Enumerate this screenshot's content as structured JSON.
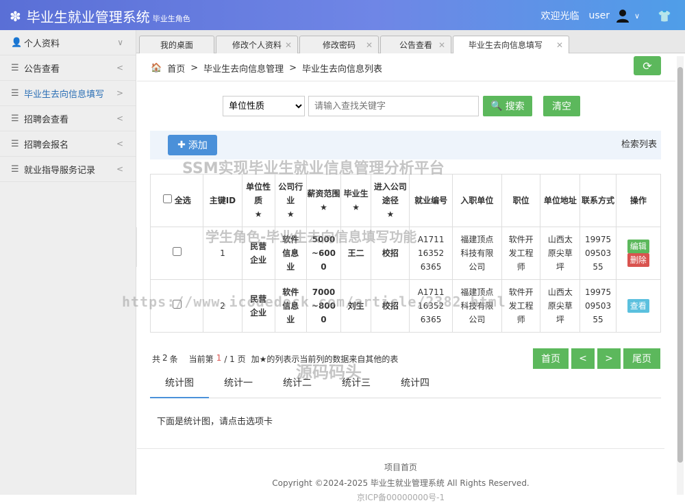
{
  "header": {
    "title": "毕业生就业管理系统",
    "role": "毕业生角色",
    "welcome": "欢迎光临",
    "username": "user"
  },
  "sidebar": {
    "items": [
      {
        "label": "个人资料",
        "icon": "user-icon",
        "arrow": "∨"
      },
      {
        "label": "公告查看",
        "icon": "list-icon",
        "arrow": "<"
      },
      {
        "label": "毕业生去向信息填写",
        "icon": "list-icon",
        "arrow": ">"
      },
      {
        "label": "招聘会查看",
        "icon": "list-icon",
        "arrow": "<"
      },
      {
        "label": "招聘会报名",
        "icon": "list-icon",
        "arrow": "<"
      },
      {
        "label": "就业指导服务记录",
        "icon": "list-icon",
        "arrow": "<"
      }
    ]
  },
  "tabs": [
    {
      "label": "我的桌面"
    },
    {
      "label": "修改个人资料"
    },
    {
      "label": "修改密码"
    },
    {
      "label": "公告查看"
    },
    {
      "label": "毕业生去向信息填写"
    }
  ],
  "breadcrumb": {
    "home": "首页",
    "level1": "毕业生去向信息管理",
    "level2": "毕业生去向信息列表"
  },
  "search": {
    "select_value": "单位性质",
    "placeholder": "请输入查找关键字",
    "search_label": "搜索",
    "clear_label": "清空"
  },
  "toolbar": {
    "add_label": "添加",
    "list_title": "检索列表"
  },
  "watermarks": {
    "w1": "SSM实现毕业生就业信息管理分析平台",
    "w2": "学生角色-毕业生去向信息填写功能",
    "w3": "https://www.icodedock.com/article/2382.html",
    "w4": "源码码头"
  },
  "table": {
    "headers": {
      "select_all": "全选",
      "id": "主键ID",
      "unit_type": "单位性质",
      "industry": "公司行业",
      "salary": "薪资范围",
      "graduate": "毕业生",
      "channel": "进入公司途径",
      "job_no": "就业编号",
      "employer": "入职单位",
      "position": "职位",
      "address": "单位地址",
      "contact": "联系方式",
      "action": "操作"
    },
    "rows": [
      {
        "id": "1",
        "unit_type": "民营企业",
        "industry": "软件信息业",
        "salary": "5000~6000",
        "graduate": "王二",
        "channel": "校招",
        "job_no": "A1711163526365",
        "employer": "福建顶点科技有限公司",
        "position": "软件开发工程师",
        "address": "山西太原尖草坪",
        "contact": "199750950355",
        "btn1": "编辑",
        "btn2": "删除"
      },
      {
        "id": "2",
        "unit_type": "民营企业",
        "industry": "软件信息业",
        "salary": "7000~8000",
        "graduate": "刘生",
        "channel": "校招",
        "job_no": "A1711163526365",
        "employer": "福建顶点科技有限公司",
        "position": "软件开发工程师",
        "address": "山西太原尖草坪",
        "contact": "199750950355",
        "btn1": "查看"
      }
    ]
  },
  "pager": {
    "total_prefix": "共",
    "total": "2",
    "total_suffix": "条",
    "current_prefix": "当前第",
    "current": "1",
    "pages": "/ 1 页",
    "note": "加★的列表示当前列的数据来自其他的表",
    "first": "首页",
    "prev": "<",
    "next": ">",
    "last": "尾页"
  },
  "stats": {
    "tabs": [
      "统计图",
      "统计一",
      "统计二",
      "统计三",
      "统计四"
    ],
    "message": "下面是统计图，请点击选项卡"
  },
  "footer": {
    "home_link": "项目首页",
    "copyright": "Copyright ©2024-2025 毕业生就业管理系统 All Rights Reserved.",
    "icp": "京ICP备00000000号-1"
  }
}
